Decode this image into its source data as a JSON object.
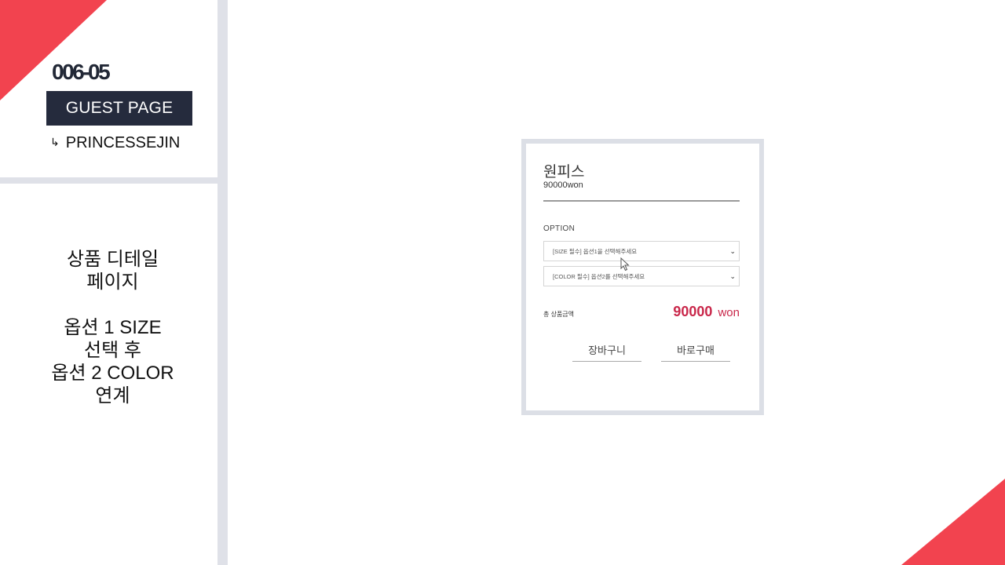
{
  "slide": {
    "code": "006-05",
    "guest_label": "GUEST PAGE",
    "author_arrow": "↳",
    "author": "PRINCESSEJIN",
    "description": {
      "line1": "상품 디테일",
      "line2": "페이지",
      "line3": "옵션 1 SIZE",
      "line4": "선택 후",
      "line5": "옵션 2 COLOR",
      "line6": "연계"
    },
    "accent_color": "#f2434f"
  },
  "product": {
    "name": "원피스",
    "price": "90000won",
    "option_label": "OPTION",
    "size_select": "[SIZE 필수] 옵션1을 선택해주세요",
    "color_select": "[COLOR 필수] 옵션2를 선택해주세요",
    "chevron": "⌄",
    "total_label": "총 상품금액",
    "total_value": "90000",
    "total_unit": "won",
    "cart_button": "장바구니",
    "buy_button": "바로구매",
    "price_color": "#c9274a"
  }
}
